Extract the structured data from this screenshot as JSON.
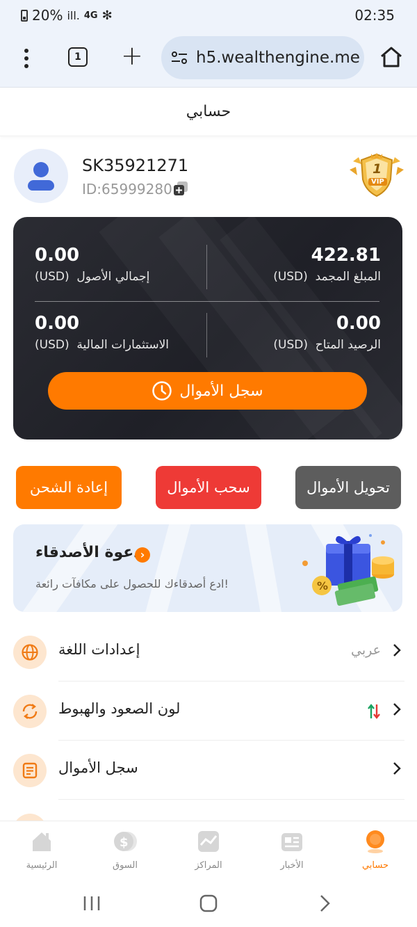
{
  "status_bar": {
    "battery": "20%",
    "signal": "ill.",
    "network": "4G",
    "bluetooth": "✻",
    "time": "02:35"
  },
  "browser": {
    "tab_count": "1",
    "url": "h5.wealthengine.me"
  },
  "page": {
    "title": "حسابي"
  },
  "profile": {
    "username": "SK35921271",
    "id": "ID:65999280",
    "vip_level": "1",
    "vip_label": "VIP"
  },
  "balances": {
    "frozen": {
      "value": "422.81",
      "label": "المبلغ المجمد",
      "unit": "(USD)"
    },
    "total_assets": {
      "value": "0.00",
      "label": "إجمالي الأصول",
      "unit": "(USD)"
    },
    "available": {
      "value": "0.00",
      "label": "الرصيد المتاح",
      "unit": "(USD)"
    },
    "investments": {
      "value": "0.00",
      "label": "الاستثمارات المالية",
      "unit": "(USD)"
    },
    "records_button": "سجل الأموال"
  },
  "actions": {
    "transfer": "تحويل الأموال",
    "withdraw": "سحب الأموال",
    "recharge": "إعادة الشحن"
  },
  "invite": {
    "title": "دعوة الأصدقاء",
    "subtitle": "ادع أصدقاءك للحصول على مكافآت رائعة!"
  },
  "settings": [
    {
      "label": "إعدادات اللغة",
      "value": "عربي",
      "icon": "globe-icon"
    },
    {
      "label": "لون الصعود والهبوط",
      "value": "",
      "icon": "updown-swap-icon"
    },
    {
      "label": "سجل الأموال",
      "value": "",
      "icon": "document-icon"
    }
  ],
  "nav": {
    "home": "الرئيسية",
    "market": "السوق",
    "positions": "المراكز",
    "news": "الأخبار",
    "account": "حسابي"
  },
  "colors": {
    "accent": "#ff7a00",
    "withdraw": "#ee3a36",
    "transfer": "#5d5d5d",
    "card": "#1f2027",
    "up": "#1aa260",
    "down": "#e53935"
  }
}
